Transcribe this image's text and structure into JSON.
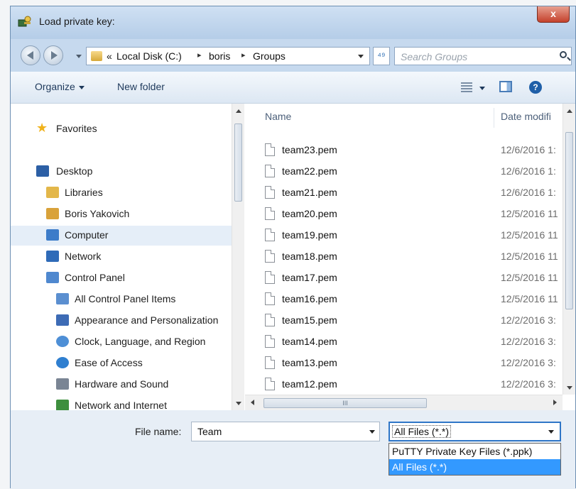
{
  "window": {
    "title": "Load private key:",
    "close_label": "x"
  },
  "address": {
    "overflow_glyph": "«",
    "crumbs": [
      "Local Disk (C:)",
      "boris",
      "Groups"
    ],
    "separator": "▸",
    "refresh_glyph": "⁴⁹",
    "search_placeholder": "Search Groups"
  },
  "toolbar": {
    "organize_label": "Organize",
    "new_folder_label": "New folder",
    "help_glyph": "?"
  },
  "nav": {
    "items": [
      {
        "label": "Favorites",
        "icon": "star-icon",
        "color": "#f0b21a"
      },
      {
        "label": "Desktop",
        "icon": "desktop-icon",
        "color": "#2c5fa5"
      },
      {
        "label": "Libraries",
        "icon": "libraries-icon",
        "color": "#e3b74a"
      },
      {
        "label": "Boris Yakovich",
        "icon": "user-folder-icon",
        "color": "#d9a23a"
      },
      {
        "label": "Computer",
        "icon": "computer-icon",
        "color": "#3d7cc9"
      },
      {
        "label": "Network",
        "icon": "network-icon",
        "color": "#2f6bb8"
      },
      {
        "label": "Control Panel",
        "icon": "control-panel-icon",
        "color": "#4f88cf"
      },
      {
        "label": "All Control Panel Items",
        "icon": "control-panel-items-icon",
        "color": "#5b8fd0"
      },
      {
        "label": "Appearance and Personalization",
        "icon": "appearance-icon",
        "color": "#3d6bb5"
      },
      {
        "label": "Clock, Language, and Region",
        "icon": "clock-globe-icon",
        "color": "#4e8fd6"
      },
      {
        "label": "Ease of Access",
        "icon": "ease-of-access-icon",
        "color": "#2f7fd0"
      },
      {
        "label": "Hardware and Sound",
        "icon": "hardware-sound-icon",
        "color": "#7a8594"
      },
      {
        "label": "Network and Internet",
        "icon": "network-internet-icon",
        "color": "#3e8f3e"
      }
    ]
  },
  "files": {
    "col_name": "Name",
    "col_date": "Date modifi",
    "rows": [
      {
        "name": "team23.pem",
        "date": "12/6/2016 1:"
      },
      {
        "name": "team22.pem",
        "date": "12/6/2016 1:"
      },
      {
        "name": "team21.pem",
        "date": "12/6/2016 1:"
      },
      {
        "name": "team20.pem",
        "date": "12/5/2016 11"
      },
      {
        "name": "team19.pem",
        "date": "12/5/2016 11"
      },
      {
        "name": "team18.pem",
        "date": "12/5/2016 11"
      },
      {
        "name": "team17.pem",
        "date": "12/5/2016 11"
      },
      {
        "name": "team16.pem",
        "date": "12/5/2016 11"
      },
      {
        "name": "team15.pem",
        "date": "12/2/2016 3:"
      },
      {
        "name": "team14.pem",
        "date": "12/2/2016 3:"
      },
      {
        "name": "team13.pem",
        "date": "12/2/2016 3:"
      },
      {
        "name": "team12.pem",
        "date": "12/2/2016 3:"
      }
    ],
    "hscroll_grip": "III"
  },
  "bottom": {
    "filename_label": "File name:",
    "filename_value": "Team",
    "filetype_value": "All Files (*.*)",
    "filetype_options": [
      "PuTTY Private Key Files (*.ppk)",
      "All Files (*.*)"
    ],
    "filetype_selected_index": 1
  }
}
